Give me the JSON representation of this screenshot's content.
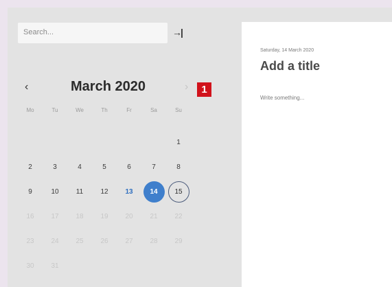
{
  "search": {
    "placeholder": "Search..."
  },
  "sidebar": {
    "collapse_icon": "collapse-sidebar-icon"
  },
  "calendar": {
    "month_label": "March 2020",
    "badge": "1",
    "weekdays": [
      "Mo",
      "Tu",
      "We",
      "Th",
      "Fr",
      "Sa",
      "Su"
    ],
    "weeks": [
      [
        "",
        "",
        "",
        "",
        "",
        "",
        "1"
      ],
      [
        "2",
        "3",
        "4",
        "5",
        "6",
        "7",
        "8"
      ],
      [
        "9",
        "10",
        "11",
        "12",
        "13",
        "14",
        "15"
      ],
      [
        "16",
        "17",
        "18",
        "19",
        "20",
        "21",
        "22"
      ],
      [
        "23",
        "24",
        "25",
        "26",
        "27",
        "28",
        "29"
      ],
      [
        "30",
        "31",
        "",
        "",
        "",
        "",
        ""
      ]
    ],
    "today": "13",
    "selected": "14",
    "outlined": "15",
    "accent_color": "#3f7fcc"
  },
  "note": {
    "date": "Saturday, 14 March 2020",
    "title_placeholder": "Add a title",
    "body_placeholder": "Write something..."
  }
}
